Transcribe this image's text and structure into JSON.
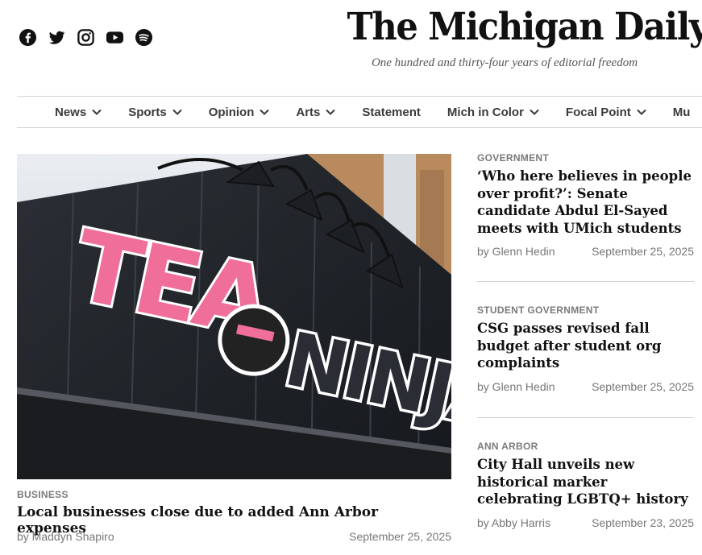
{
  "social": [
    {
      "name": "facebook-icon"
    },
    {
      "name": "twitter-icon"
    },
    {
      "name": "instagram-icon"
    },
    {
      "name": "youtube-icon"
    },
    {
      "name": "spotify-icon"
    }
  ],
  "masthead": {
    "logo": "The Michigan Daily",
    "tagline": "One hundred and thirty-four years of editorial freedom"
  },
  "nav": {
    "items": [
      {
        "label": "News",
        "dropdown": true
      },
      {
        "label": "Sports",
        "dropdown": true
      },
      {
        "label": "Opinion",
        "dropdown": true
      },
      {
        "label": "Arts",
        "dropdown": true
      },
      {
        "label": "Statement",
        "dropdown": false
      },
      {
        "label": "Mich in Color",
        "dropdown": true
      },
      {
        "label": "Focal Point",
        "dropdown": true
      },
      {
        "label": "Mu",
        "dropdown": false
      }
    ]
  },
  "main_article": {
    "category": "BUSINESS",
    "title": "Local businesses close due to added Ann Arbor expenses",
    "author": "by Maddyn Shapiro",
    "date": "September 25, 2025",
    "image_sign_text": "TEA NINJA"
  },
  "side_articles": [
    {
      "category": "GOVERNMENT",
      "title": "‘Who here believes in people over profit?’: Senate candidate Abdul El-Sayed meets with UMich students",
      "author": "by Glenn Hedin",
      "date": "September 25, 2025"
    },
    {
      "category": "STUDENT GOVERNMENT",
      "title": "CSG passes revised fall budget after student org complaints",
      "author": "by Glenn Hedin",
      "date": "September 25, 2025"
    },
    {
      "category": "ANN ARBOR",
      "title": "City Hall unveils new historical marker celebrating LGBTQ+ history",
      "author": "by Abby Harris",
      "date": "September 23, 2025"
    }
  ]
}
